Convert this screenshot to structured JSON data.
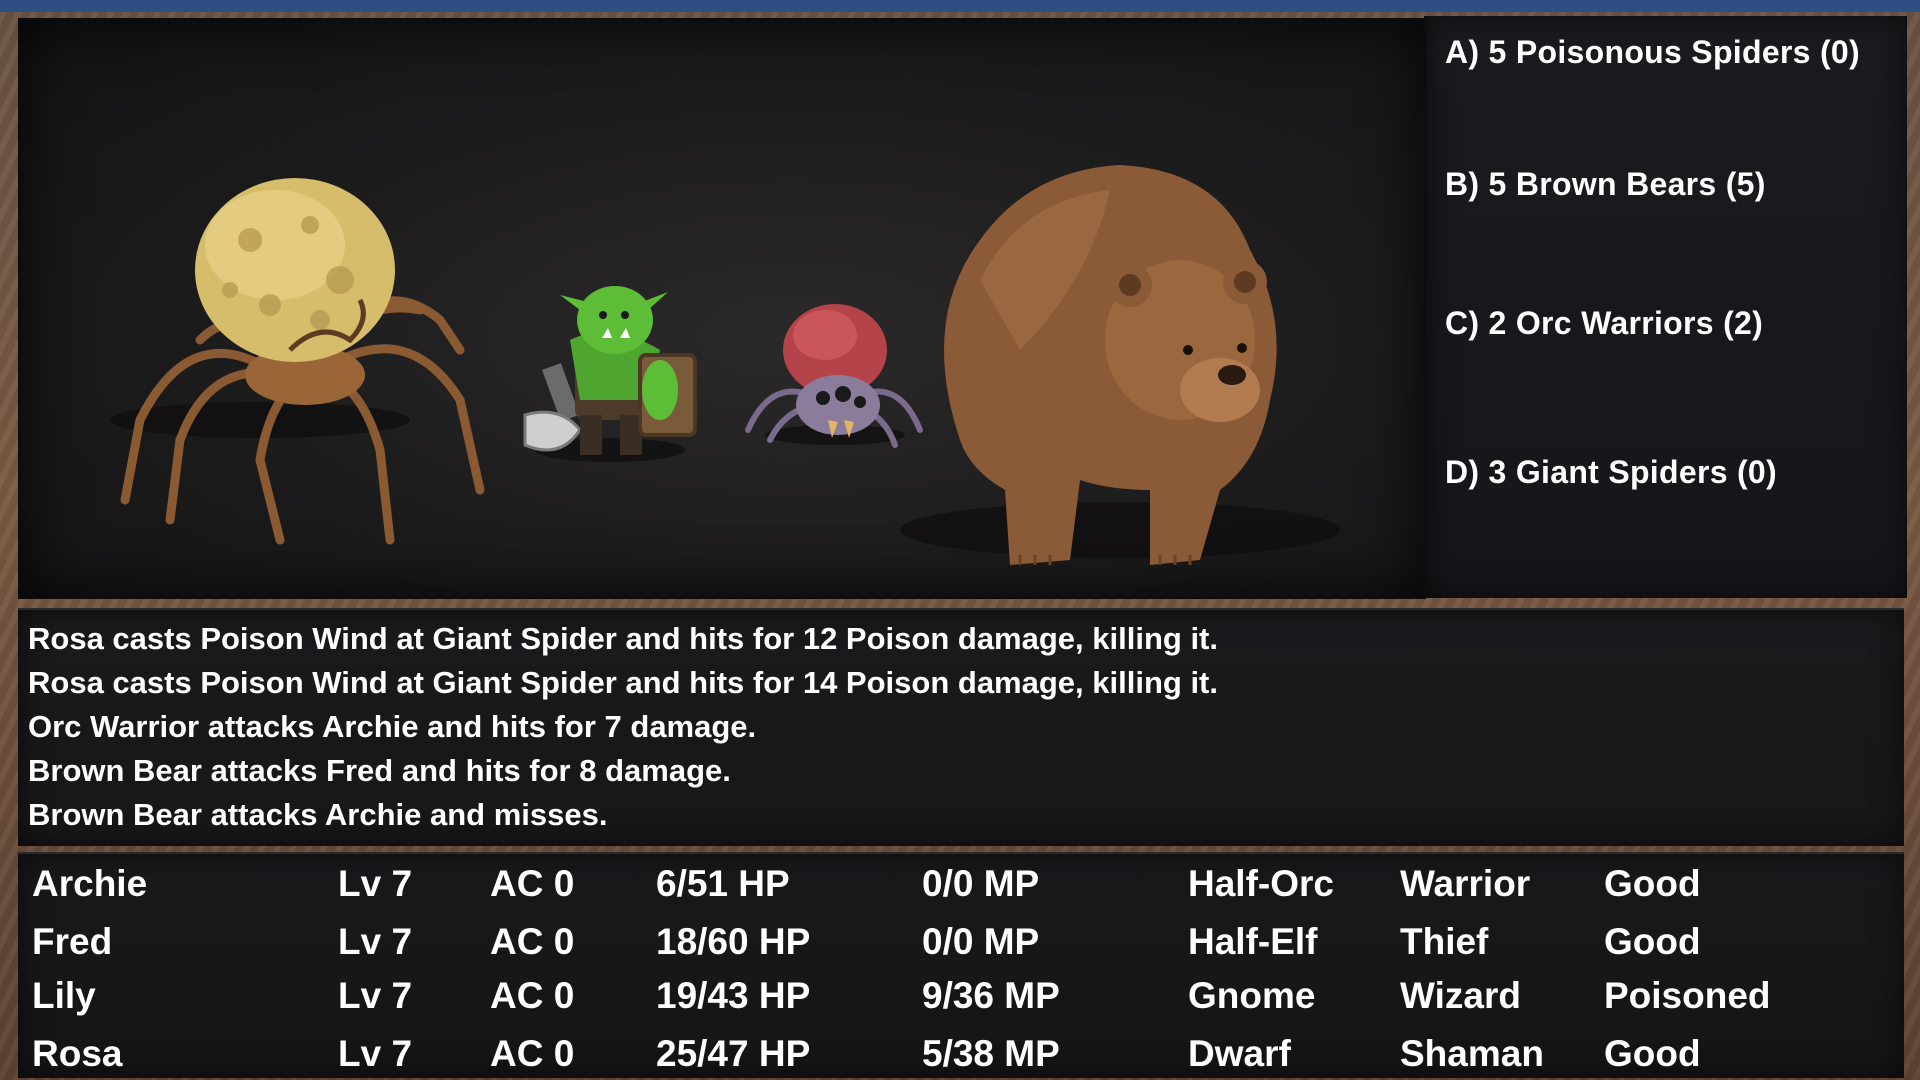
{
  "enemy_groups": [
    {
      "label": "A) 5 Poisonous Spiders (0)"
    },
    {
      "label": "B) 5 Brown Bears (5)"
    },
    {
      "label": "C) 2 Orc Warriors (2)"
    },
    {
      "label": "D) 3 Giant Spiders (0)"
    }
  ],
  "combat_log": [
    "Rosa casts Poison Wind at Giant Spider and hits for 12 Poison damage, killing it.",
    "Rosa casts Poison Wind at Giant Spider and hits for 14 Poison damage, killing it.",
    "Orc Warrior attacks Archie and hits for 7 damage.",
    "Brown Bear attacks Fred and hits for 8 damage.",
    "Brown Bear attacks Archie and misses."
  ],
  "party": [
    {
      "name": "Archie",
      "level": "Lv 7",
      "ac": "AC 0",
      "hp": "6/51 HP",
      "mp": "0/0 MP",
      "race": "Half-Orc",
      "class": "Warrior",
      "status": "Good"
    },
    {
      "name": "Fred",
      "level": "Lv 7",
      "ac": "AC 0",
      "hp": "18/60 HP",
      "mp": "0/0 MP",
      "race": "Half-Elf",
      "class": "Thief",
      "status": "Good"
    },
    {
      "name": "Lily",
      "level": "Lv 7",
      "ac": "AC 0",
      "hp": "19/43 HP",
      "mp": "9/36 MP",
      "race": "Gnome",
      "class": "Wizard",
      "status": "Poisoned"
    },
    {
      "name": "Rosa",
      "level": "Lv 7",
      "ac": "AC 0",
      "hp": "25/47 HP",
      "mp": "5/38 MP",
      "race": "Dwarf",
      "class": "Shaman",
      "status": "Good"
    }
  ],
  "colors": {
    "panel_bg": "#18181b",
    "text": "#ffffff",
    "top_bar": "#2f4e86"
  },
  "icons": {
    "enemy_1": "giant-spider-sprite",
    "enemy_2": "orc-warrior-sprite",
    "enemy_3": "poisonous-spider-sprite",
    "enemy_4": "brown-bear-sprite"
  }
}
